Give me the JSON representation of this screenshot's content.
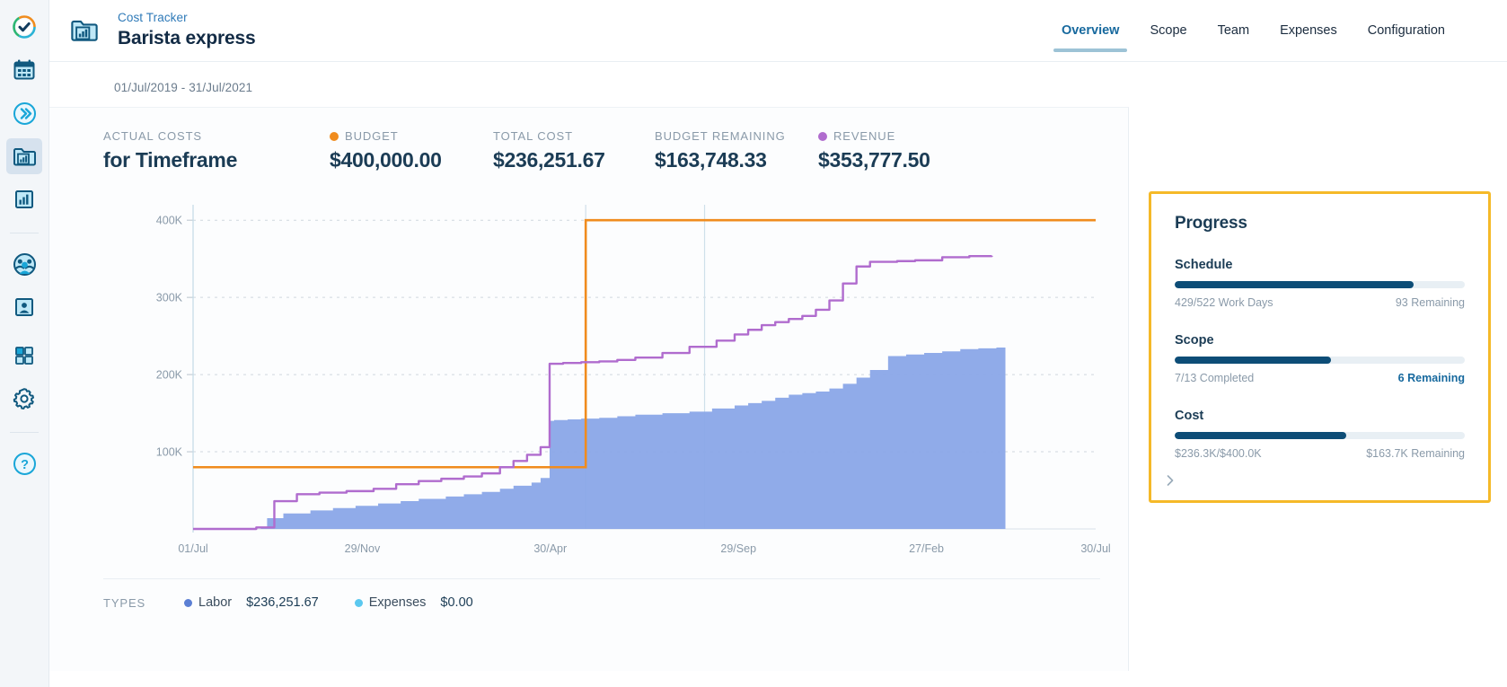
{
  "sidebar": {
    "items": [
      {
        "icon": "check-circle-icon",
        "name": "sidebar-item-home",
        "active": false
      },
      {
        "icon": "calendar-icon",
        "name": "sidebar-item-calendar",
        "active": false
      },
      {
        "icon": "chevrons-right-icon",
        "name": "sidebar-item-forward",
        "active": false
      },
      {
        "icon": "folder-chart-icon",
        "name": "sidebar-item-cost-tracker",
        "active": true
      },
      {
        "icon": "bar-chart-icon",
        "name": "sidebar-item-reports",
        "active": false
      },
      {
        "icon": "people-group-icon",
        "name": "sidebar-item-team",
        "active": false
      },
      {
        "icon": "person-card-icon",
        "name": "sidebar-item-contacts",
        "active": false
      },
      {
        "icon": "grid-apps-icon",
        "name": "sidebar-item-apps",
        "active": false
      },
      {
        "icon": "gear-icon",
        "name": "sidebar-item-settings",
        "active": false
      },
      {
        "icon": "help-circle-icon",
        "name": "sidebar-item-help",
        "active": false
      }
    ]
  },
  "header": {
    "breadcrumb": "Cost Tracker",
    "title": "Barista express",
    "project_icon": "folder-chart-icon",
    "tabs": [
      {
        "label": "Overview",
        "active": true
      },
      {
        "label": "Scope",
        "active": false
      },
      {
        "label": "Team",
        "active": false
      },
      {
        "label": "Expenses",
        "active": false
      },
      {
        "label": "Configuration",
        "active": false
      }
    ]
  },
  "date_range": "01/Jul/2019 - 31/Jul/2021",
  "kpis": [
    {
      "label": "ACTUAL COSTS",
      "value": "for Timeframe",
      "dot": null
    },
    {
      "label": "BUDGET",
      "value": "$400,000.00",
      "dot": "#f08c1e"
    },
    {
      "label": "TOTAL COST",
      "value": "$236,251.67",
      "dot": null
    },
    {
      "label": "BUDGET REMAINING",
      "value": "$163,748.33",
      "dot": null
    },
    {
      "label": "REVENUE",
      "value": "$353,777.50",
      "dot": "#b06cce"
    }
  ],
  "legend": {
    "title": "TYPES",
    "items": [
      {
        "name": "Labor",
        "value": "$236,251.67",
        "color": "#5b7fd4"
      },
      {
        "name": "Expenses",
        "value": "$0.00",
        "color": "#5bc8ef"
      }
    ]
  },
  "progress": {
    "title": "Progress",
    "expand_icon": "chevron-right-icon",
    "groups": [
      {
        "label": "Schedule",
        "percent": 82.2,
        "left": "429/522 Work Days",
        "right": "93 Remaining",
        "right_is_link": false
      },
      {
        "label": "Scope",
        "percent": 53.8,
        "left": "7/13 Completed",
        "right": "6 Remaining",
        "right_is_link": true
      },
      {
        "label": "Cost",
        "percent": 59.1,
        "left": "$236.3K/$400.0K",
        "right": "$163.7K Remaining",
        "right_is_link": false
      }
    ]
  },
  "colors": {
    "budget_line": "#f08c1e",
    "revenue_line": "#b06cce",
    "labor_area": "#8aa7e8",
    "expenses": "#5bc8ef",
    "progress_fill": "#0d4d77",
    "progress_track": "#e8eff4",
    "panel_border": "#f5b928",
    "accent": "#17699e"
  },
  "chart_data": {
    "type": "area",
    "title": "Actual Costs for Timeframe",
    "xlabel": "",
    "ylabel": "",
    "ylim": [
      0,
      420000
    ],
    "yticks": [
      100000,
      200000,
      300000,
      400000
    ],
    "ytick_labels": [
      "100K",
      "200K",
      "300K",
      "400K"
    ],
    "xtick_labels": [
      "01/Jul",
      "29/Nov",
      "30/Apr",
      "29/Sep",
      "27/Feb",
      "30/Jul"
    ],
    "xtick_positions": [
      0,
      0.1875,
      0.3958,
      0.6042,
      0.8125,
      1.0
    ],
    "grid": true,
    "legend_position": "bottom",
    "series": [
      {
        "name": "Labor",
        "type": "area",
        "color": "#8aa7e8",
        "total": 236251.67,
        "x": [
          0.0,
          0.045,
          0.075,
          0.082,
          0.1,
          0.13,
          0.155,
          0.18,
          0.205,
          0.23,
          0.25,
          0.28,
          0.3,
          0.32,
          0.34,
          0.355,
          0.375,
          0.385,
          0.395,
          0.4,
          0.415,
          0.43,
          0.45,
          0.47,
          0.49,
          0.52,
          0.55,
          0.575,
          0.6,
          0.615,
          0.63,
          0.645,
          0.66,
          0.675,
          0.69,
          0.705,
          0.72,
          0.735,
          0.75,
          0.77,
          0.79,
          0.81,
          0.83,
          0.85,
          0.87,
          0.89,
          0.9
        ],
        "y": [
          0,
          0,
          2000,
          14000,
          20000,
          24000,
          27000,
          30000,
          33000,
          36000,
          39000,
          42000,
          45000,
          48000,
          52000,
          56000,
          60000,
          66000,
          140000,
          141000,
          142000,
          143000,
          144000,
          146000,
          148000,
          150000,
          152000,
          156000,
          160000,
          163000,
          166000,
          170000,
          174000,
          176000,
          178000,
          182000,
          188000,
          196000,
          206000,
          224000,
          226000,
          228000,
          230000,
          233000,
          234000,
          235000,
          236251
        ]
      },
      {
        "name": "Expenses",
        "type": "area",
        "color": "#5bc8ef",
        "total": 0.0,
        "x": [
          0.0,
          0.9
        ],
        "y": [
          0,
          0
        ]
      },
      {
        "name": "Revenue",
        "type": "line",
        "color": "#b06cce",
        "total": 353777.5,
        "x": [
          0.0,
          0.045,
          0.07,
          0.09,
          0.115,
          0.14,
          0.17,
          0.2,
          0.225,
          0.25,
          0.275,
          0.3,
          0.32,
          0.34,
          0.355,
          0.37,
          0.385,
          0.395,
          0.41,
          0.43,
          0.45,
          0.47,
          0.49,
          0.52,
          0.55,
          0.58,
          0.6,
          0.615,
          0.63,
          0.645,
          0.66,
          0.675,
          0.69,
          0.705,
          0.72,
          0.735,
          0.75,
          0.78,
          0.8,
          0.83,
          0.86,
          0.885
        ],
        "y": [
          0,
          0,
          2000,
          36000,
          45000,
          47000,
          49000,
          52000,
          58000,
          62000,
          65000,
          68000,
          72000,
          80000,
          88000,
          96000,
          106000,
          214000,
          215000,
          216000,
          217000,
          219000,
          222000,
          228000,
          236000,
          244000,
          252000,
          258000,
          264000,
          268000,
          272000,
          276000,
          284000,
          296000,
          318000,
          340000,
          346000,
          347000,
          348000,
          352000,
          353500,
          353777
        ]
      },
      {
        "name": "Budget",
        "type": "step-line",
        "color": "#f08c1e",
        "total": 400000.0,
        "x": [
          0.0,
          0.435,
          0.435,
          1.0
        ],
        "y": [
          80000,
          80000,
          400000,
          400000
        ]
      }
    ],
    "vertical_markers": [
      0.435,
      0.5667
    ]
  }
}
